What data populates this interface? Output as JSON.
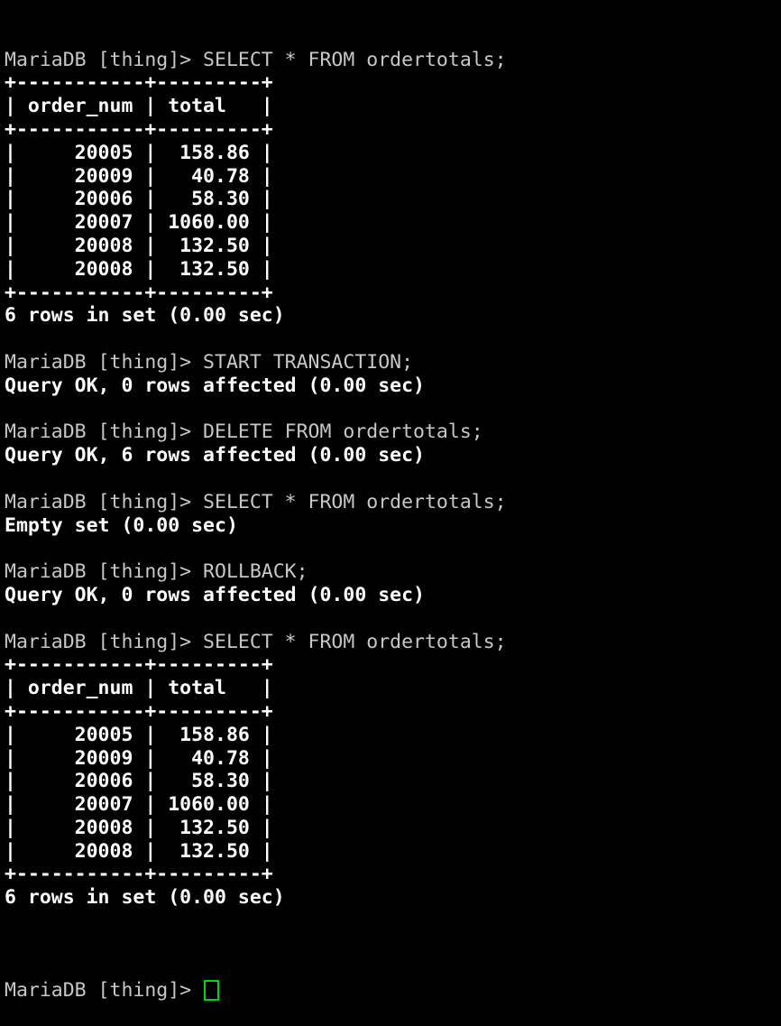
{
  "terminal": {
    "app": "MariaDB client",
    "prompt": "MariaDB [thing]> ",
    "database": "thing",
    "background_color": "#000000",
    "command_color": "#c5c8c6",
    "result_color": "#ffffff",
    "cursor_color": "#00d407",
    "cursor_style": "hollow-block",
    "table_name": "ordertotals",
    "columns": [
      "order_num",
      "total"
    ],
    "rows": [
      [
        "20005",
        "158.86"
      ],
      [
        "20009",
        "40.78"
      ],
      [
        "20006",
        "58.30"
      ],
      [
        "20007",
        "1060.00"
      ],
      [
        "20008",
        "132.50"
      ],
      [
        "20008",
        "132.50"
      ]
    ],
    "separator": "+-----------+---------+",
    "header_row": "| order_num | total   |",
    "lines": [
      {
        "kind": "cmd",
        "text": "MariaDB [thing]> SELECT * FROM ordertotals;"
      },
      {
        "kind": "res",
        "text": "+-----------+---------+"
      },
      {
        "kind": "res",
        "text": "| order_num | total   |"
      },
      {
        "kind": "res",
        "text": "+-----------+---------+"
      },
      {
        "kind": "res",
        "text": "|     20005 |  158.86 |"
      },
      {
        "kind": "res",
        "text": "|     20009 |   40.78 |"
      },
      {
        "kind": "res",
        "text": "|     20006 |   58.30 |"
      },
      {
        "kind": "res",
        "text": "|     20007 | 1060.00 |"
      },
      {
        "kind": "res",
        "text": "|     20008 |  132.50 |"
      },
      {
        "kind": "res",
        "text": "|     20008 |  132.50 |"
      },
      {
        "kind": "res",
        "text": "+-----------+---------+"
      },
      {
        "kind": "res",
        "text": "6 rows in set (0.00 sec)"
      },
      {
        "kind": "blank",
        "text": " "
      },
      {
        "kind": "cmd",
        "text": "MariaDB [thing]> START TRANSACTION;"
      },
      {
        "kind": "res",
        "text": "Query OK, 0 rows affected (0.00 sec)"
      },
      {
        "kind": "blank",
        "text": " "
      },
      {
        "kind": "cmd",
        "text": "MariaDB [thing]> DELETE FROM ordertotals;"
      },
      {
        "kind": "res",
        "text": "Query OK, 6 rows affected (0.00 sec)"
      },
      {
        "kind": "blank",
        "text": " "
      },
      {
        "kind": "cmd",
        "text": "MariaDB [thing]> SELECT * FROM ordertotals;"
      },
      {
        "kind": "res",
        "text": "Empty set (0.00 sec)"
      },
      {
        "kind": "blank",
        "text": " "
      },
      {
        "kind": "cmd",
        "text": "MariaDB [thing]> ROLLBACK;"
      },
      {
        "kind": "res",
        "text": "Query OK, 0 rows affected (0.00 sec)"
      },
      {
        "kind": "blank",
        "text": " "
      },
      {
        "kind": "cmd",
        "text": "MariaDB [thing]> SELECT * FROM ordertotals;"
      },
      {
        "kind": "res",
        "text": "+-----------+---------+"
      },
      {
        "kind": "res",
        "text": "| order_num | total   |"
      },
      {
        "kind": "res",
        "text": "+-----------+---------+"
      },
      {
        "kind": "res",
        "text": "|     20005 |  158.86 |"
      },
      {
        "kind": "res",
        "text": "|     20009 |   40.78 |"
      },
      {
        "kind": "res",
        "text": "|     20006 |   58.30 |"
      },
      {
        "kind": "res",
        "text": "|     20007 | 1060.00 |"
      },
      {
        "kind": "res",
        "text": "|     20008 |  132.50 |"
      },
      {
        "kind": "res",
        "text": "|     20008 |  132.50 |"
      },
      {
        "kind": "res",
        "text": "+-----------+---------+"
      },
      {
        "kind": "res",
        "text": "6 rows in set (0.00 sec)"
      },
      {
        "kind": "blank",
        "text": " "
      }
    ],
    "final_prompt": "MariaDB [thing]> "
  }
}
